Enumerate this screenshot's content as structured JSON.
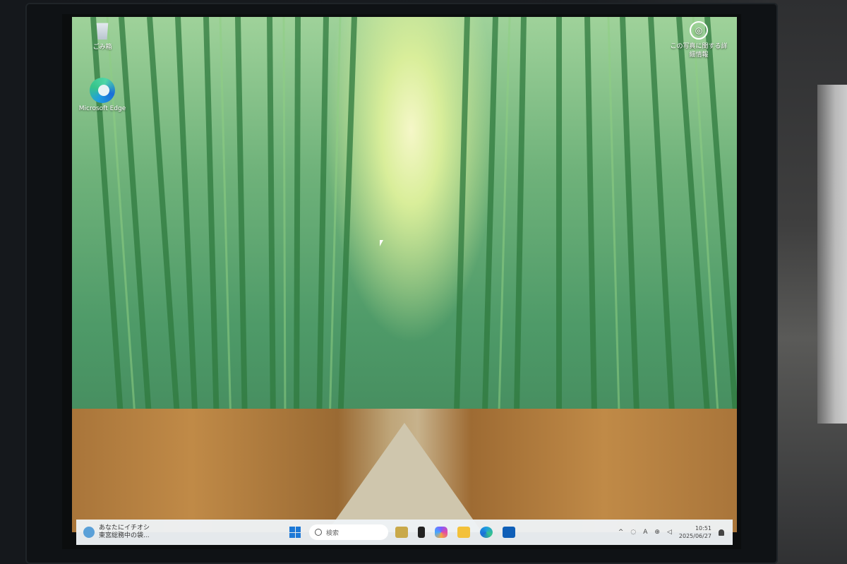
{
  "desktop": {
    "icons": [
      {
        "label": "ごみ箱"
      },
      {
        "label": "Microsoft Edge"
      }
    ],
    "info_widget": {
      "line1": "この写真に関する詳",
      "line2": "細情報"
    }
  },
  "taskbar": {
    "weather": {
      "line1": "あなたにイチオシ",
      "line2": "東宮総務中の袋..."
    },
    "search_placeholder": "検索",
    "tray": {
      "time": "10:51",
      "date": "2025/06/27",
      "lang": "A",
      "chevron": "^"
    }
  }
}
